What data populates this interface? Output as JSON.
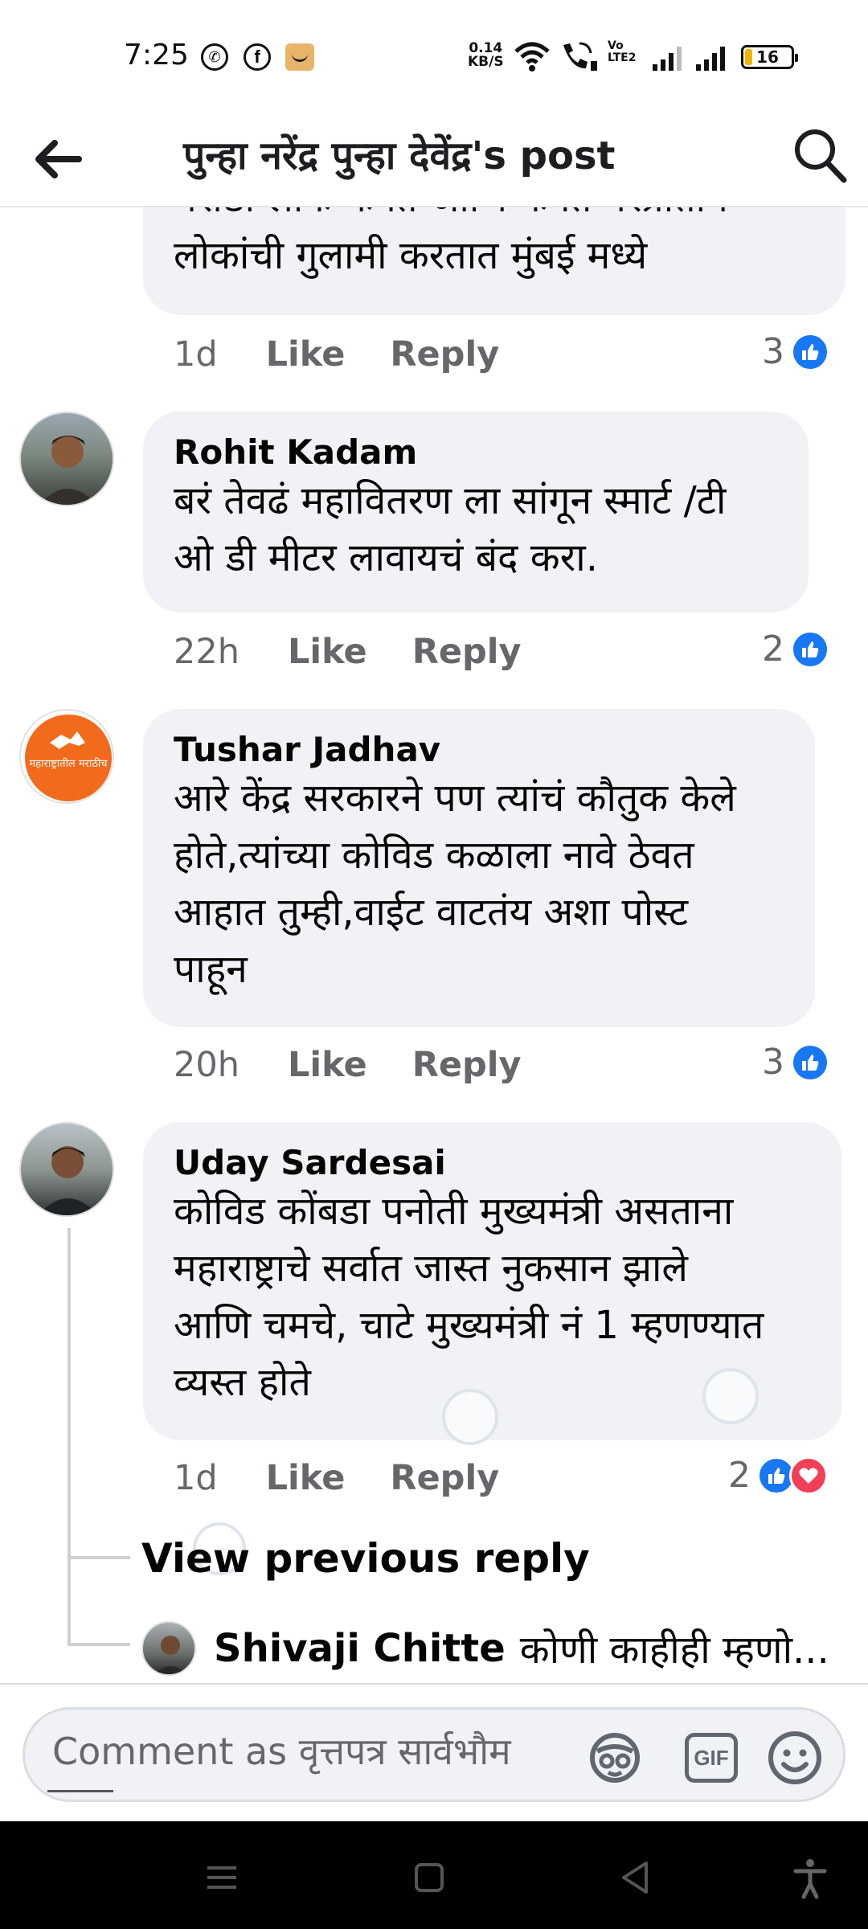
{
  "status_bar": {
    "time": "7:25",
    "net_speed_value": "0.14",
    "net_speed_unit": "KB/S",
    "volte_top": "Vo",
    "volte_bottom": "LTE2",
    "battery": "16",
    "battery_level": 0.16,
    "notification_icons": [
      "whatsapp-icon",
      "facebook-icon",
      "amazon-icon"
    ]
  },
  "header": {
    "title": "पुन्हा नरेंद्र पुन्हा देवेंद्र's post",
    "back_icon": "arrow-left-icon",
    "search_icon": "search-icon"
  },
  "colors": {
    "bubble": "#f0f2f5",
    "like_blue": "#1877f2",
    "love_red": "#f33e58",
    "meta_gray": "#65676b"
  },
  "comments": [
    {
      "author": "",
      "text_lines": [
        "मराठी लोक फक्त आणि फक्त परप्रांतीय",
        "लोकांची गुलामी करतात मुंबई मध्ये"
      ],
      "time": "1d",
      "like_label": "Like",
      "reply_label": "Reply",
      "reaction_count": "3",
      "reactions": [
        "like"
      ]
    },
    {
      "author": "Rohit Kadam",
      "text_lines": [
        "बरं तेवढं महावितरण ला सांगून स्मार्ट /टी",
        "ओ डी मीटर लावायचं बंद करा."
      ],
      "time": "22h",
      "like_label": "Like",
      "reply_label": "Reply",
      "reaction_count": "2",
      "reactions": [
        "like"
      ]
    },
    {
      "author": "Tushar Jadhav",
      "text_lines": [
        "आरे केंद्र सरकारने पण त्यांचं कौतुक केले",
        "होते,त्यांच्या कोविड कळाला नावे ठेवत",
        "आहात तुम्ही,वाईट वाटतंय अशा पोस्ट",
        "पाहून"
      ],
      "avatar_text": "महाराष्ट्रातील मराठीच",
      "time": "20h",
      "like_label": "Like",
      "reply_label": "Reply",
      "reaction_count": "3",
      "reactions": [
        "like"
      ]
    },
    {
      "author": "Uday Sardesai",
      "text_lines": [
        "कोविड कोंबडा पनोती मुख्यमंत्री असताना",
        "महाराष्ट्राचे सर्वात जास्त नुकसान झाले",
        "आणि चमचे, चाटे मुख्यमंत्री नं 1 म्हणण्यात",
        "व्यस्त होते"
      ],
      "time": "1d",
      "like_label": "Like",
      "reply_label": "Reply",
      "reaction_count": "2",
      "reactions": [
        "like",
        "love"
      ]
    }
  ],
  "thread": {
    "view_previous_label": "View previous reply",
    "reply_author": "Shivaji Chitte",
    "reply_preview": "कोणी काहीही म्हणो..."
  },
  "composer": {
    "placeholder": "Comment as वृत्तपत्र सार्वभौम",
    "sticker_icon": "sticker-icon",
    "gif_label": "GIF",
    "emoji_icon": "emoji-icon"
  },
  "navbar": {
    "buttons": [
      "menu-icon",
      "home-square-icon",
      "back-triangle-icon",
      "accessibility-icon"
    ]
  }
}
